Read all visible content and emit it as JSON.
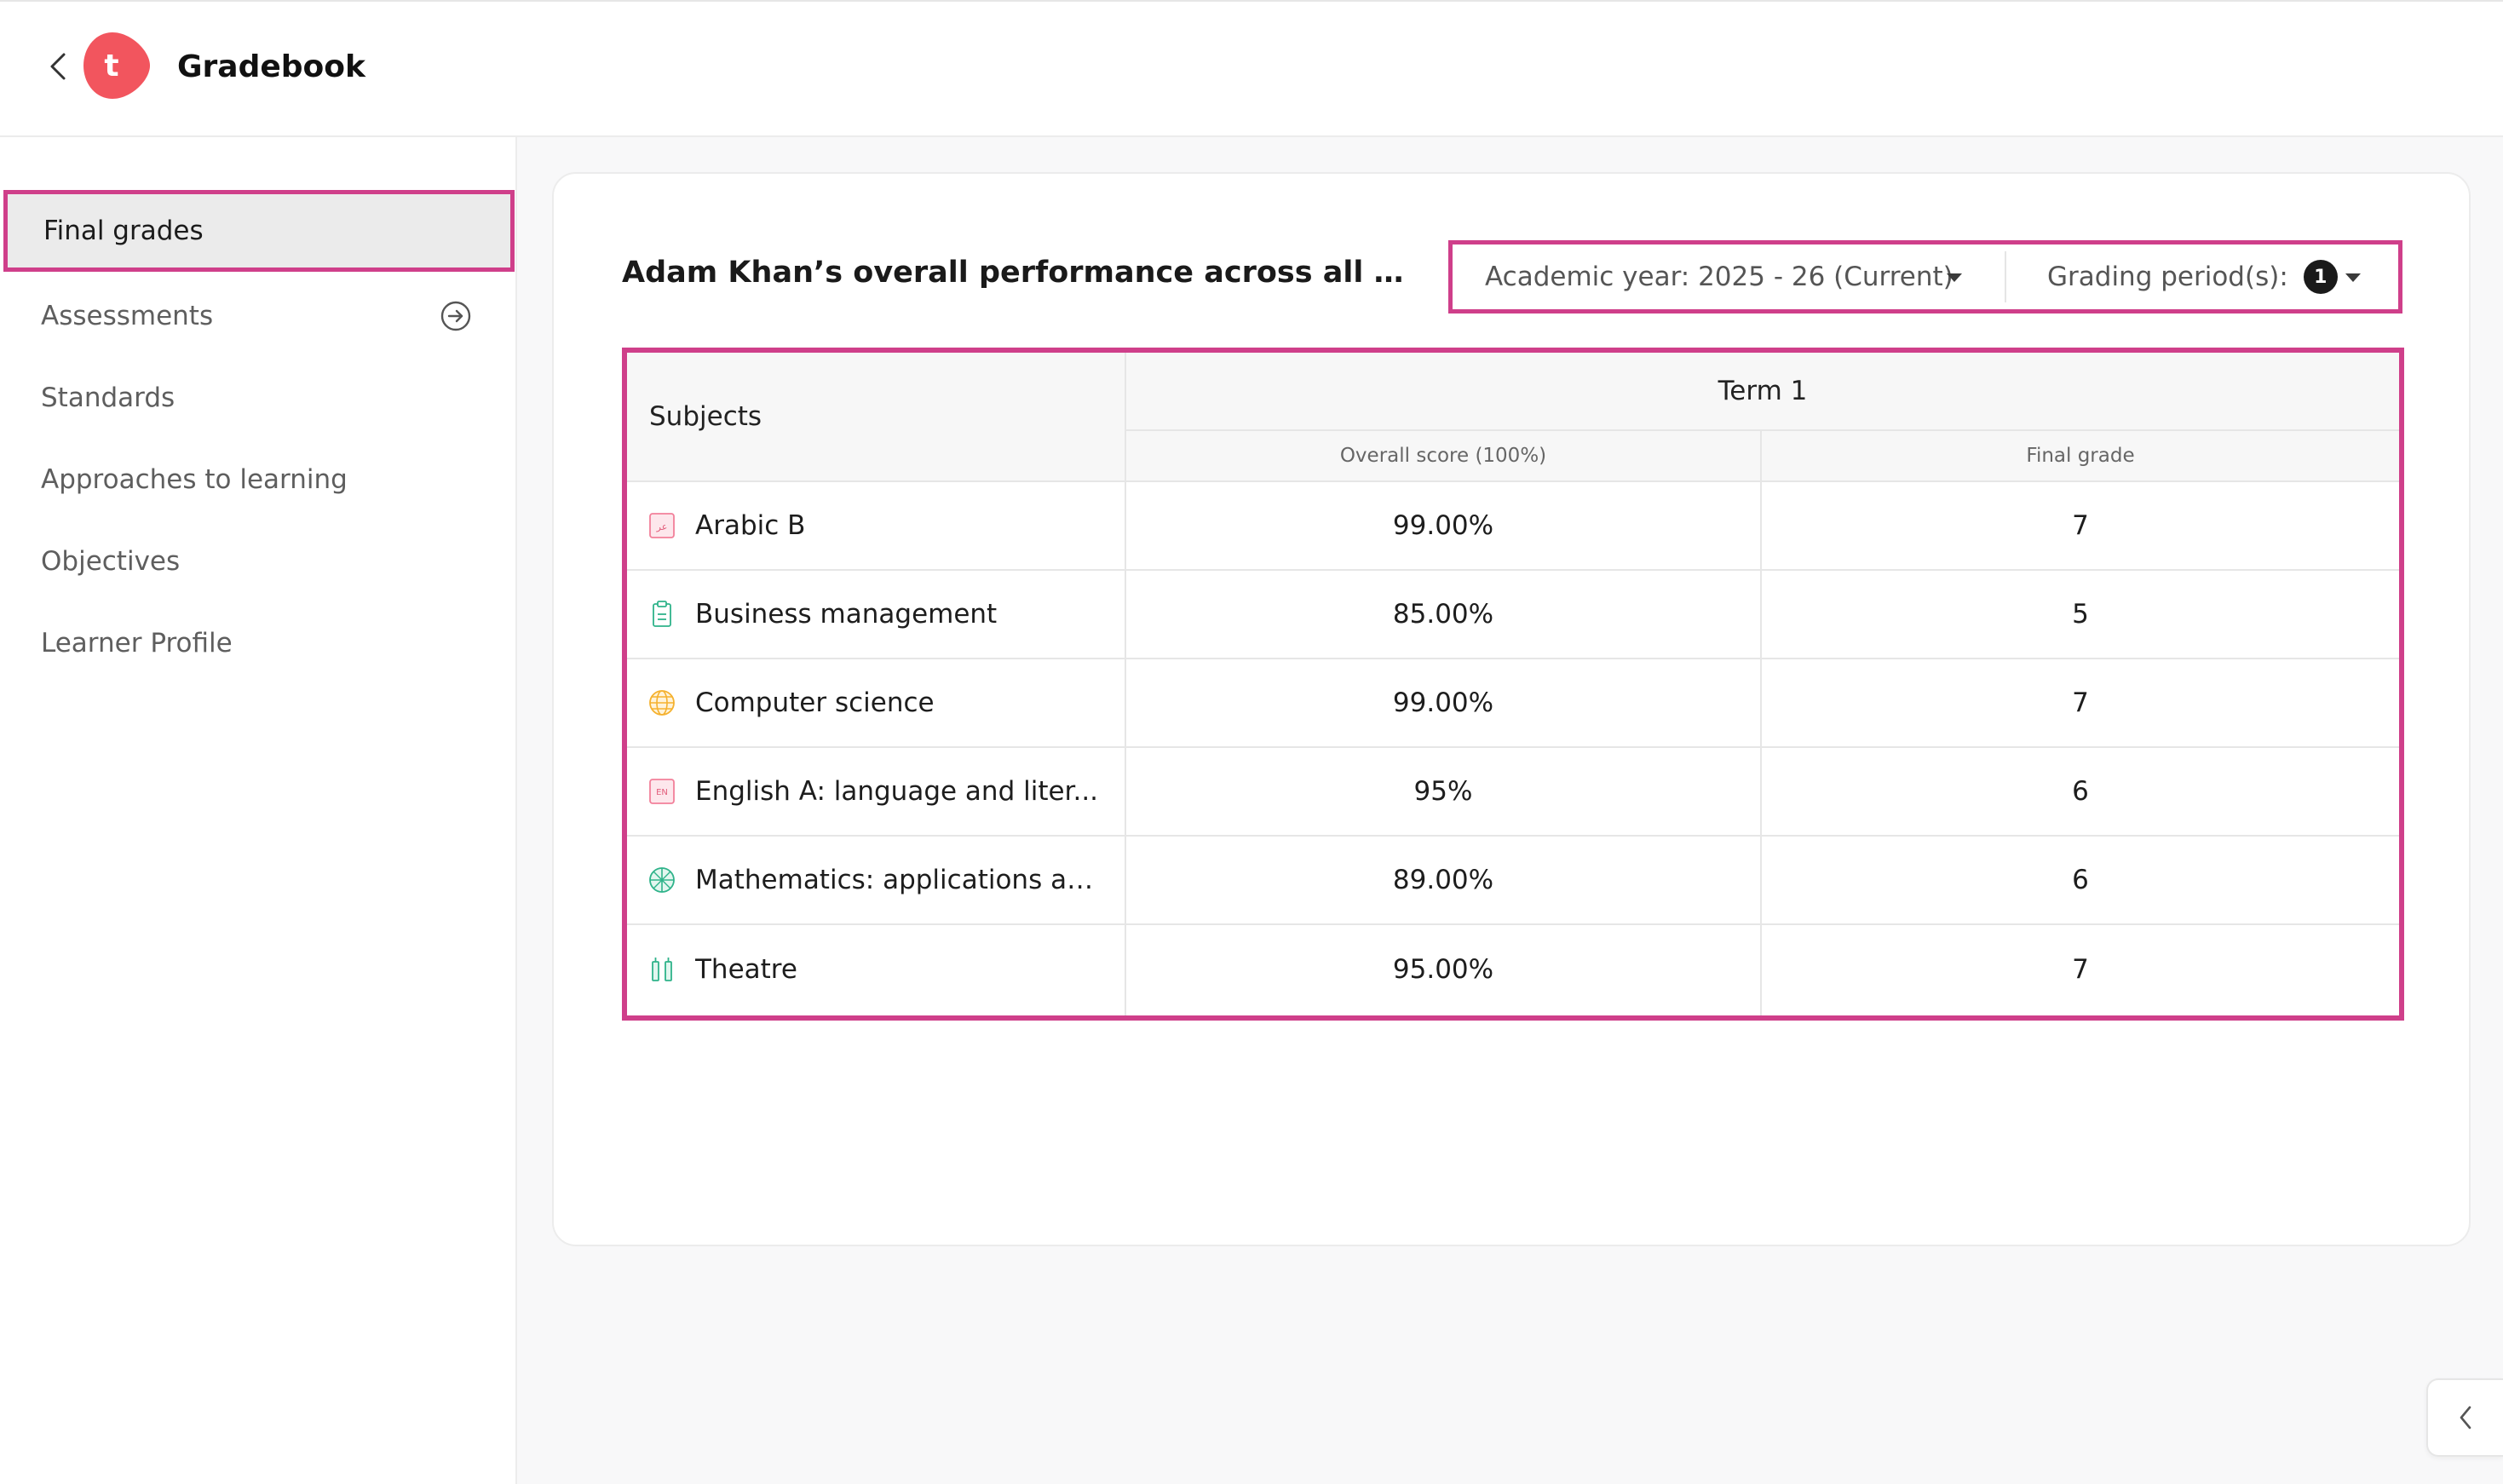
{
  "header": {
    "app_title": "Gradebook",
    "logo_letter": "t",
    "brand_color": "#f2555e"
  },
  "sidebar": {
    "items": [
      {
        "label": "Final grades",
        "active": true
      },
      {
        "label": "Assessments",
        "icon": "arrow-circle-right-icon"
      },
      {
        "label": "Standards"
      },
      {
        "label": "Approaches to learning"
      },
      {
        "label": "Objectives"
      },
      {
        "label": "Learner Profile"
      }
    ]
  },
  "main": {
    "title": "Adam Khan’s overall performance across all grading p...",
    "filters": {
      "academic_year": "Academic year: 2025 - 26 (Current)",
      "grading_period": "Grading period(s):",
      "grading_period_count": "1"
    },
    "table": {
      "subjects_header": "Subjects",
      "term_header": "Term 1",
      "score_header": "Overall score (100%)",
      "grade_header": "Final grade",
      "rows": [
        {
          "subject": "Arabic B",
          "icon": "language-arabic-icon",
          "score": "99.00%",
          "grade": "7"
        },
        {
          "subject": "Business management",
          "icon": "clipboard-icon",
          "score": "85.00%",
          "grade": "5"
        },
        {
          "subject": "Computer science",
          "icon": "globe-icon",
          "score": "99.00%",
          "grade": "7"
        },
        {
          "subject": "English A: language and liter...",
          "icon": "language-english-icon",
          "score": "95%",
          "grade": "6"
        },
        {
          "subject": "Mathematics: applications an...",
          "icon": "compass-grid-icon",
          "score": "89.00%",
          "grade": "6"
        },
        {
          "subject": "Theatre",
          "icon": "theatre-icon",
          "score": "95.00%",
          "grade": "7"
        }
      ]
    }
  },
  "colors": {
    "highlight": "#cf3f8a",
    "arabic_icon": "#f2809a",
    "business_icon": "#2fb38a",
    "computer_icon": "#f5b12e",
    "english_icon": "#f2809a",
    "math_icon": "#2fb38a",
    "theatre_icon": "#2fb38a"
  }
}
